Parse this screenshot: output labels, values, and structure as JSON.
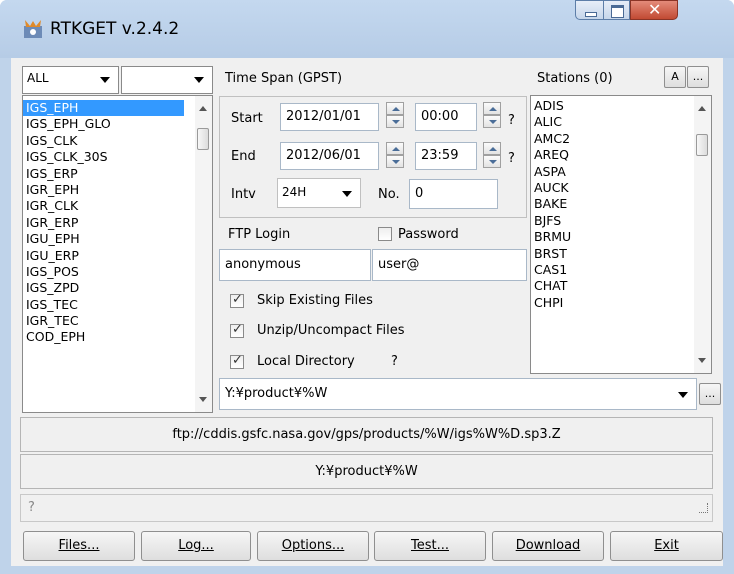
{
  "window": {
    "title": "RTKGET v.2.4.2"
  },
  "types": {
    "filter1": "ALL",
    "filter2": "",
    "items": [
      "IGS_EPH",
      "IGS_EPH_GLO",
      "IGS_CLK",
      "IGS_CLK_30S",
      "IGS_ERP",
      "IGR_EPH",
      "IGR_CLK",
      "IGR_ERP",
      "IGU_EPH",
      "IGU_ERP",
      "IGS_POS",
      "IGS_ZPD",
      "IGS_TEC",
      "IGR_TEC",
      "COD_EPH"
    ],
    "selected": "IGS_EPH"
  },
  "time": {
    "header": "Time Span (GPST)",
    "start_label": "Start",
    "start_date": "2012/01/01",
    "start_time": "00:00",
    "end_label": "End",
    "end_date": "2012/06/01",
    "end_time": "23:59",
    "help": "?",
    "intv_label": "Intv",
    "intv_value": "24H",
    "no_label": "No.",
    "no_value": "0"
  },
  "ftp": {
    "login_label": "FTP Login",
    "password_label": "Password",
    "user": "anonymous",
    "password": "user@"
  },
  "options": {
    "skip_existing": "Skip Existing Files",
    "unzip": "Unzip/Uncompact Files",
    "local_dir": "Local Directory",
    "local_dir_help": "?"
  },
  "stations": {
    "header": "Stations (0)",
    "btn_a": "A",
    "btn_more": "...",
    "items": [
      "ADIS",
      "ALIC",
      "AMC2",
      "AREQ",
      "ASPA",
      "AUCK",
      "BAKE",
      "BJFS",
      "BRMU",
      "BRST",
      "CAS1",
      "CHAT",
      "CHPI"
    ]
  },
  "path": {
    "dir": "Y:¥product¥%W",
    "browse": "..."
  },
  "info": {
    "url": "ftp://cddis.gsfc.nasa.gov/gps/products/%W/igs%W%D.sp3.Z",
    "local": "Y:¥product¥%W",
    "status": "?"
  },
  "buttons": {
    "files": "Files...",
    "log": "Log...",
    "options": "Options...",
    "test": "Test...",
    "download": "Download",
    "exit": "Exit"
  }
}
